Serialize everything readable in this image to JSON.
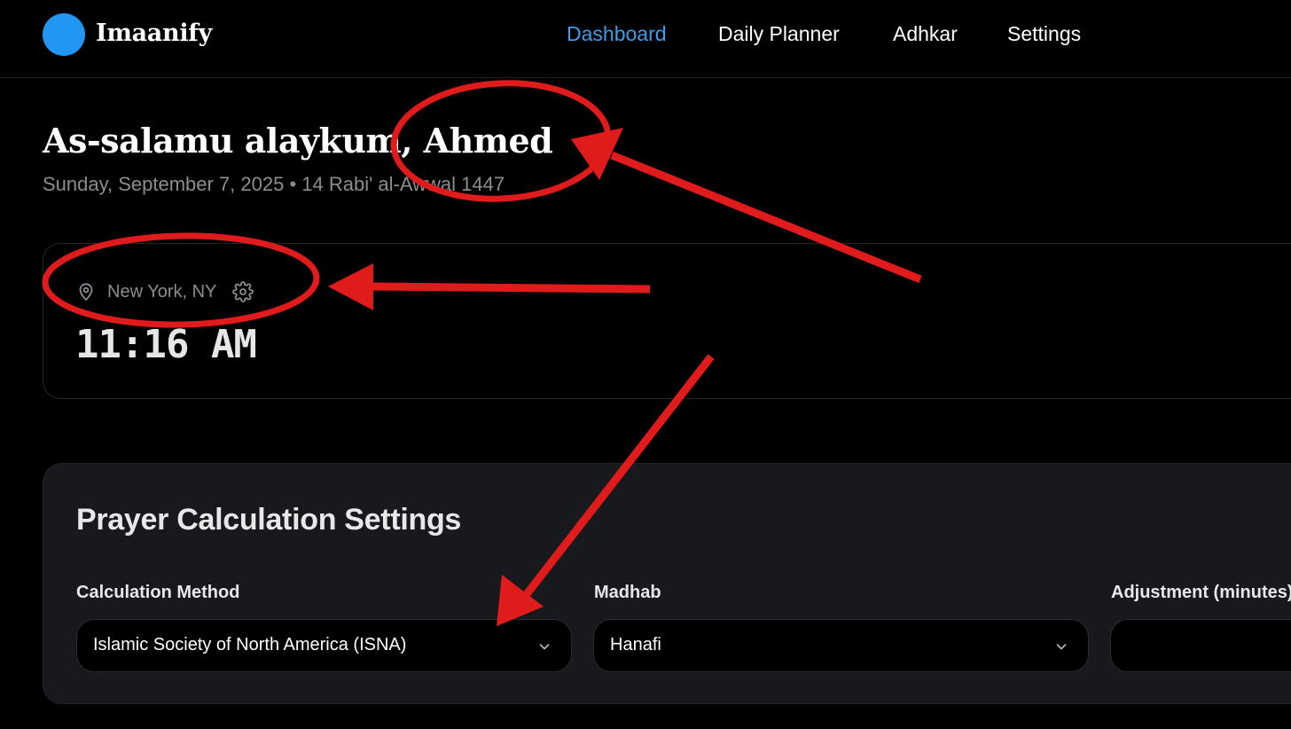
{
  "app": {
    "brand": "Imaanify",
    "accent_color": "#3b9eea",
    "logo_color": "#2196f3"
  },
  "nav": {
    "items": [
      {
        "label": "Dashboard",
        "active": true
      },
      {
        "label": "Daily Planner",
        "active": false
      },
      {
        "label": "Adhkar",
        "active": false
      },
      {
        "label": "Settings",
        "active": false
      }
    ]
  },
  "greeting": {
    "text": "As-salamu alaykum, Ahmed",
    "date_line": "Sunday, September 7, 2025 • 14 Rabi' al-Awwal 1447"
  },
  "location_card": {
    "location": "New York, NY",
    "location_icon": "map-pin-icon",
    "settings_icon": "gear-icon",
    "time": "11:16 AM"
  },
  "prayer_settings": {
    "title": "Prayer Calculation Settings",
    "calculation_method": {
      "label": "Calculation Method",
      "value": "Islamic Society of North America (ISNA)"
    },
    "madhab": {
      "label": "Madhab",
      "value": "Hanafi"
    },
    "adjustment": {
      "label": "Adjustment (minutes)",
      "value": ""
    }
  },
  "annotation_color": "#e01b1b"
}
